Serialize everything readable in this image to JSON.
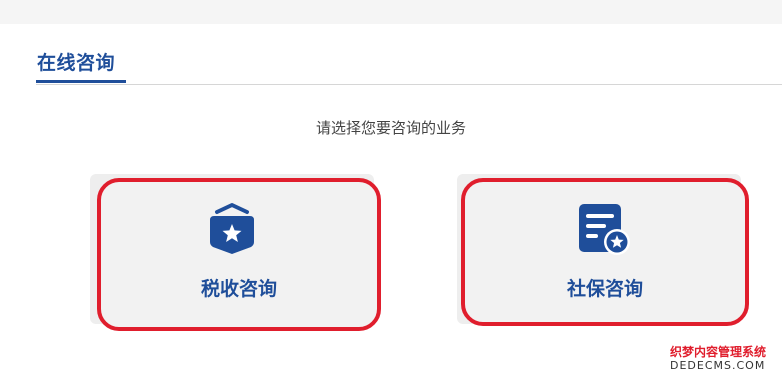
{
  "tabs": {
    "active": "在线咨询"
  },
  "prompt": "请选择您要咨询的业务",
  "cards": [
    {
      "label": "税收咨询",
      "icon": "shield-star-icon"
    },
    {
      "label": "社保咨询",
      "icon": "document-star-icon"
    }
  ],
  "colors": {
    "brand": "#1f4e9a",
    "highlight": "#e01e2d"
  },
  "watermark": {
    "line1": "织梦内容管理系统",
    "line2": "DEDECMS.COM"
  }
}
